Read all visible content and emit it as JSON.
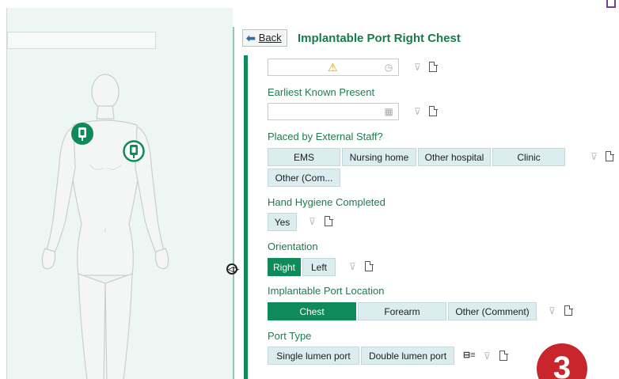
{
  "header": {
    "back_label": "Back",
    "title": "Implantable Port Right Chest"
  },
  "fields": {
    "earliest_known_present": {
      "label": "Earliest Known Present"
    },
    "placed_by_external_staff": {
      "label": "Placed by External Staff?",
      "options": [
        "EMS",
        "Nursing home",
        "Other hospital",
        "Clinic",
        "Other (Com..."
      ]
    },
    "hand_hygiene": {
      "label": "Hand Hygiene Completed",
      "options": [
        "Yes"
      ]
    },
    "orientation": {
      "label": "Orientation",
      "options": [
        "Right",
        "Left"
      ],
      "selected": "Right"
    },
    "port_location": {
      "label": "Implantable Port Location",
      "options": [
        "Chest",
        "Forearm",
        "Other (Comment)"
      ],
      "selected": "Chest"
    },
    "port_type": {
      "label": "Port Type",
      "options": [
        "Single lumen port",
        "Double lumen port"
      ]
    }
  },
  "badge": {
    "text": "3"
  },
  "colors": {
    "accent_green": "#0f8a5a",
    "label_green": "#1e7b4f",
    "option_bg": "#dcedf0",
    "badge_red": "#c9252c"
  },
  "icons": [
    "warning-icon",
    "clock-icon",
    "calendar-icon",
    "filter-icon",
    "document-icon",
    "port-marker-icon",
    "list-icon"
  ]
}
